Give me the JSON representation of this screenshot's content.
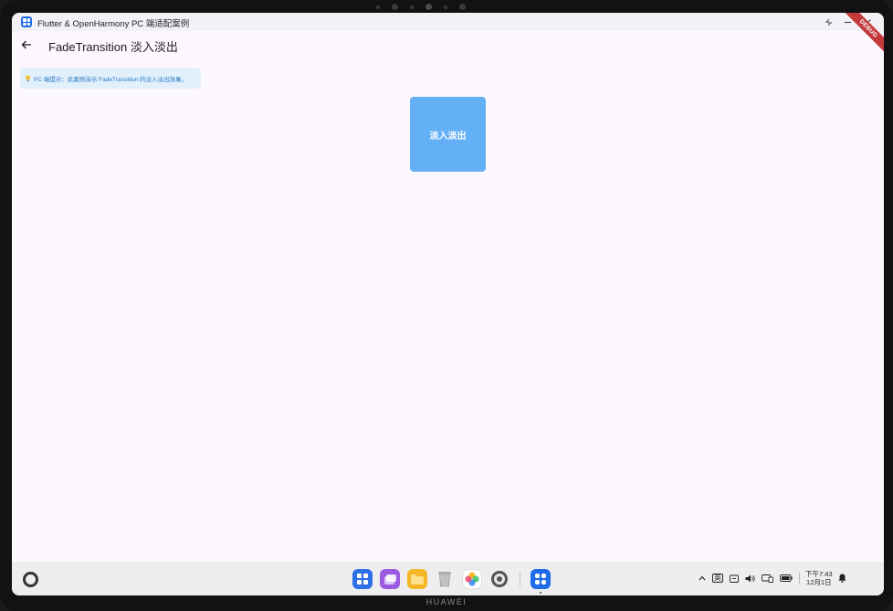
{
  "window": {
    "title": "Flutter & OpenHarmony PC 端适配案例",
    "controls": [
      "collapse",
      "minimize",
      "close"
    ]
  },
  "appbar": {
    "back_icon": "arrow-left-icon",
    "title": "FadeTransition 淡入淡出"
  },
  "debug_banner": "DEBUG",
  "tip": {
    "icon": "lightbulb-icon",
    "text": "PC 端提示：此案例演示 FadeTransition 的淡入淡出效果。"
  },
  "fade_box": {
    "label": "淡入淡出",
    "color": "#64b0f6"
  },
  "taskbar": {
    "dock_items": [
      "app-center-icon",
      "multi-window-icon",
      "files-icon",
      "trash-icon",
      "gallery-icon",
      "settings-icon",
      "flutter-app-icon"
    ],
    "tray": {
      "ime": "英",
      "clock_time": "下午7:43",
      "clock_date": "12月1日"
    }
  },
  "device": {
    "brand": "HUAWEI"
  }
}
